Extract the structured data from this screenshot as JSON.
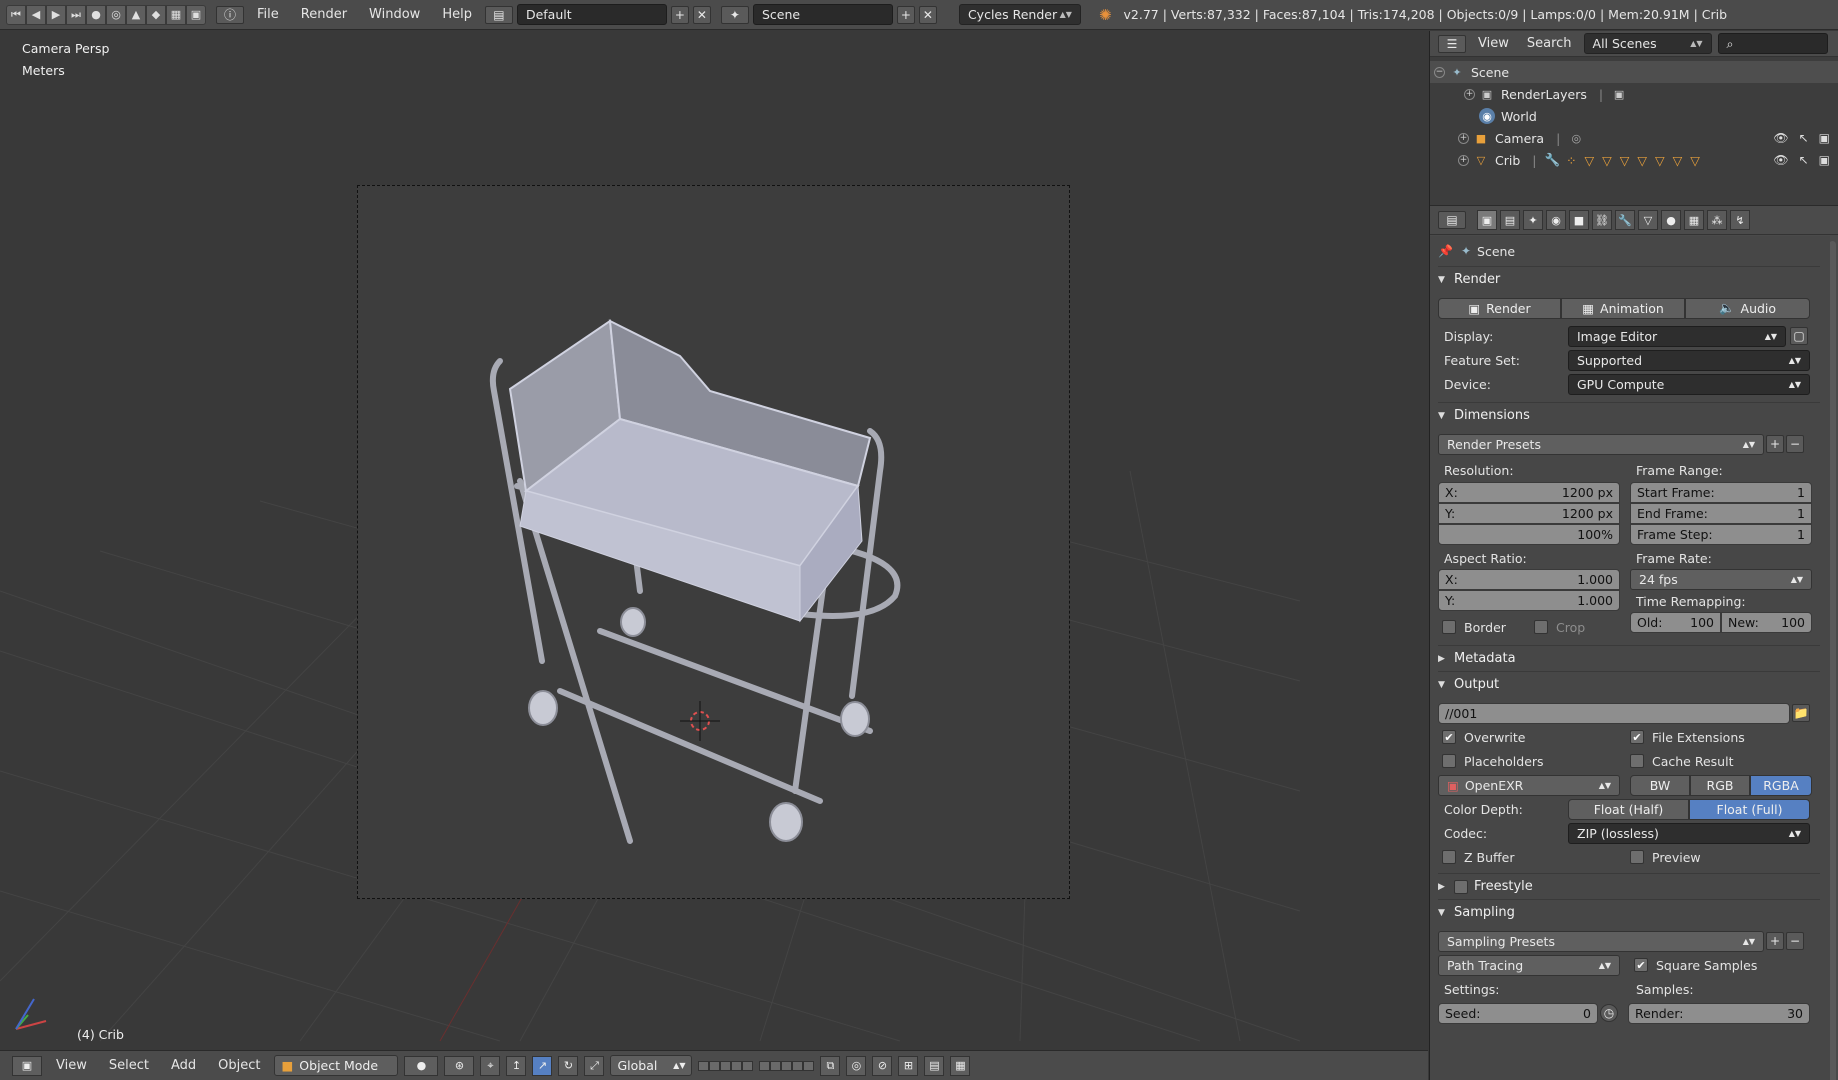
{
  "top": {
    "menus": [
      "File",
      "Render",
      "Window",
      "Help"
    ],
    "layout": "Default",
    "scene": "Scene",
    "engine": "Cycles Render",
    "stats": "v2.77 | Verts:87,332 | Faces:87,104 | Tris:174,208 | Objects:0/9 | Lamps:0/0 | Mem:20.91M | Crib"
  },
  "viewport": {
    "view_name": "Camera Persp",
    "units": "Meters",
    "active_object": "(4) Crib"
  },
  "bottom": {
    "menus": [
      "View",
      "Select",
      "Add",
      "Object"
    ],
    "mode": "Object Mode",
    "orientation": "Global"
  },
  "outliner": {
    "menu_view": "View",
    "menu_search": "Search",
    "filter": "All Scenes",
    "rows": [
      {
        "label": "Scene"
      },
      {
        "label": "RenderLayers"
      },
      {
        "label": "World"
      },
      {
        "label": "Camera"
      },
      {
        "label": "Crib"
      }
    ]
  },
  "props": {
    "context": "Scene",
    "render": {
      "title": "Render",
      "btn_render": "Render",
      "btn_animation": "Animation",
      "btn_audio": "Audio",
      "display_label": "Display:",
      "display_value": "Image Editor",
      "feature_label": "Feature Set:",
      "feature_value": "Supported",
      "device_label": "Device:",
      "device_value": "GPU Compute"
    },
    "dimensions": {
      "title": "Dimensions",
      "presets": "Render Presets",
      "resolution_label": "Resolution:",
      "res_x_k": "X:",
      "res_x": "1200 px",
      "res_y_k": "Y:",
      "res_y": "1200 px",
      "res_pct": "100%",
      "frame_range_label": "Frame Range:",
      "start_k": "Start Frame:",
      "start": "1",
      "end_k": "End Frame:",
      "end": "1",
      "step_k": "Frame Step:",
      "step": "1",
      "aspect_label": "Aspect Ratio:",
      "asp_x_k": "X:",
      "asp_x": "1.000",
      "asp_y_k": "Y:",
      "asp_y": "1.000",
      "frame_rate_label": "Frame Rate:",
      "frame_rate": "24 fps",
      "time_remap_label": "Time Remapping:",
      "old_k": "Old:",
      "old": "100",
      "new_k": "New:",
      "new": "100",
      "border": "Border",
      "crop": "Crop"
    },
    "metadata": {
      "title": "Metadata"
    },
    "output": {
      "title": "Output",
      "path": "//001",
      "overwrite": "Overwrite",
      "file_ext": "File Extensions",
      "placeholders": "Placeholders",
      "cache": "Cache Result",
      "format": "OpenEXR",
      "bw": "BW",
      "rgb": "RGB",
      "rgba": "RGBA",
      "depth_label": "Color Depth:",
      "depth_half": "Float (Half)",
      "depth_full": "Float (Full)",
      "codec_label": "Codec:",
      "codec": "ZIP (lossless)",
      "zbuffer": "Z Buffer",
      "preview": "Preview"
    },
    "freestyle": {
      "title": "Freestyle"
    },
    "sampling": {
      "title": "Sampling",
      "presets": "Sampling Presets",
      "integrator": "Path Tracing",
      "square": "Square Samples",
      "settings_label": "Settings:",
      "samples_label": "Samples:",
      "seed_k": "Seed:",
      "seed": "0",
      "render_k": "Render:",
      "render": "30"
    }
  },
  "colors": {
    "accent": "#5680c2",
    "panel": "#474747",
    "viewport": "#393939"
  }
}
